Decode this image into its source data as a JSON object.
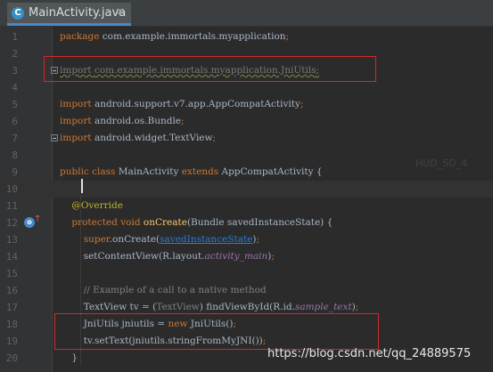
{
  "tab": {
    "filename": "MainActivity.java",
    "icon_letter": "C",
    "close_glyph": "✕"
  },
  "lines": [
    {
      "n": "1",
      "segments": [
        {
          "t": "package ",
          "c": "kw"
        },
        {
          "t": "com.example.immortals.myapplication",
          "c": ""
        },
        {
          "t": ";",
          "c": "kw"
        }
      ]
    },
    {
      "n": "2",
      "segments": []
    },
    {
      "n": "3",
      "segments": [
        {
          "t": "import ",
          "c": "unused"
        },
        {
          "t": "com.example.immortals.myapplication.JniUtils",
          "c": "unused"
        },
        {
          "t": ";",
          "c": "unused"
        }
      ]
    },
    {
      "n": "4",
      "segments": []
    },
    {
      "n": "5",
      "segments": [
        {
          "t": "import ",
          "c": "kw"
        },
        {
          "t": "android.support.v7.app.AppCompatActivity",
          "c": ""
        },
        {
          "t": ";",
          "c": "kw"
        }
      ]
    },
    {
      "n": "6",
      "segments": [
        {
          "t": "import ",
          "c": "kw"
        },
        {
          "t": "android.os.Bundle",
          "c": ""
        },
        {
          "t": ";",
          "c": "kw"
        }
      ]
    },
    {
      "n": "7",
      "segments": [
        {
          "t": "import ",
          "c": "kw"
        },
        {
          "t": "android.widget.TextView",
          "c": ""
        },
        {
          "t": ";",
          "c": "kw"
        }
      ]
    },
    {
      "n": "8",
      "segments": []
    },
    {
      "n": "9",
      "segments": [
        {
          "t": "public class ",
          "c": "kw"
        },
        {
          "t": "MainActivity ",
          "c": ""
        },
        {
          "t": "extends ",
          "c": "kw"
        },
        {
          "t": "AppCompatActivity {",
          "c": ""
        }
      ]
    },
    {
      "n": "10",
      "segments": []
    },
    {
      "n": "11",
      "segments": [
        {
          "t": "    ",
          "c": ""
        },
        {
          "t": "@Override",
          "c": "ann"
        }
      ]
    },
    {
      "n": "12",
      "segments": [
        {
          "t": "    ",
          "c": ""
        },
        {
          "t": "protected void ",
          "c": "kw"
        },
        {
          "t": "onCreate",
          "c": "fn"
        },
        {
          "t": "(Bundle savedInstanceState) {",
          "c": ""
        }
      ]
    },
    {
      "n": "13",
      "segments": [
        {
          "t": "        ",
          "c": ""
        },
        {
          "t": "super",
          "c": "kw"
        },
        {
          "t": ".onCreate(",
          "c": ""
        },
        {
          "t": "savedInstanceState",
          "c": "ul"
        },
        {
          "t": ")",
          "c": ""
        },
        {
          "t": ";",
          "c": "kw"
        }
      ]
    },
    {
      "n": "14",
      "segments": [
        {
          "t": "        setContentView(R.layout.",
          "c": ""
        },
        {
          "t": "activity_main",
          "c": "it"
        },
        {
          "t": ")",
          "c": ""
        },
        {
          "t": ";",
          "c": "kw"
        }
      ]
    },
    {
      "n": "15",
      "segments": []
    },
    {
      "n": "16",
      "segments": [
        {
          "t": "        ",
          "c": ""
        },
        {
          "t": "// Example of a call to a native method",
          "c": "cm"
        }
      ]
    },
    {
      "n": "17",
      "segments": [
        {
          "t": "        TextView tv = (",
          "c": ""
        },
        {
          "t": "TextView",
          "c": "grey"
        },
        {
          "t": ") findViewById(R.id.",
          "c": ""
        },
        {
          "t": "sample_text",
          "c": "it"
        },
        {
          "t": ")",
          "c": ""
        },
        {
          "t": ";",
          "c": "kw"
        }
      ]
    },
    {
      "n": "18",
      "segments": [
        {
          "t": "        JniUtils jniutils = ",
          "c": ""
        },
        {
          "t": "new ",
          "c": "kw"
        },
        {
          "t": "JniUtils()",
          "c": ""
        },
        {
          "t": ";",
          "c": "kw"
        }
      ]
    },
    {
      "n": "19",
      "segments": [
        {
          "t": "        tv.setText(jniutils.stringFromMyJNI())",
          "c": ""
        },
        {
          "t": ";",
          "c": "kw"
        }
      ]
    },
    {
      "n": "20",
      "segments": [
        {
          "t": "    }",
          "c": ""
        }
      ]
    }
  ],
  "watermark": "https://blog.csdn.net/qq_24889575",
  "faint_watermark": "HUD_SD_4",
  "colors": {
    "keyword": "#cc7832",
    "function": "#ffc66d",
    "annotation": "#bbb529",
    "comment": "#808080",
    "field": "#9876aa",
    "link": "#287bde",
    "highlight_box": "#d12b2b",
    "background": "#2b2b2b"
  }
}
